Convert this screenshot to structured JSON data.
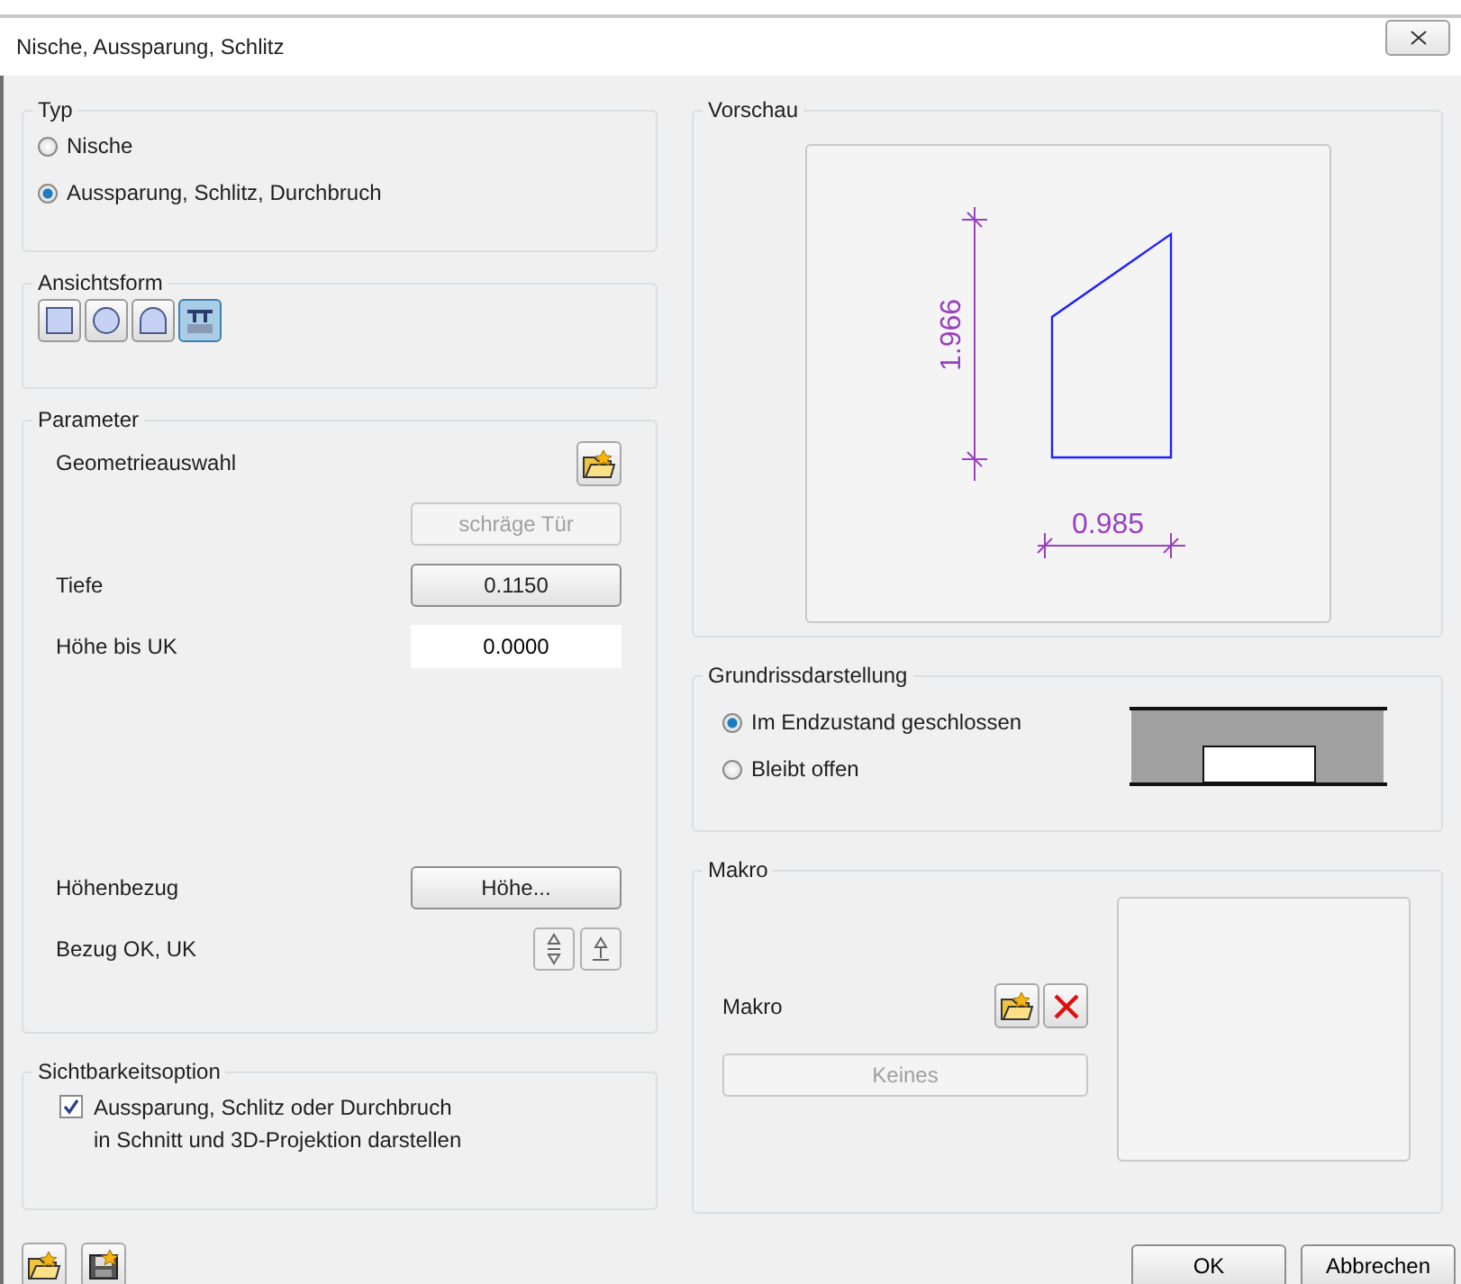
{
  "window": {
    "title": "Nische, Aussparung, Schlitz"
  },
  "typ": {
    "title": "Typ",
    "options": [
      {
        "label": "Nische",
        "selected": false
      },
      {
        "label": "Aussparung, Schlitz, Durchbruch",
        "selected": true
      }
    ]
  },
  "ansichtsform": {
    "title": "Ansichtsform",
    "shapes": [
      {
        "kind": "rectangle",
        "selected": false
      },
      {
        "kind": "circle",
        "selected": false
      },
      {
        "kind": "arch",
        "selected": false
      },
      {
        "kind": "custom",
        "selected": true
      }
    ]
  },
  "parameter": {
    "title": "Parameter",
    "rows": [
      {
        "kind": "icon",
        "label": "Geometrieauswahl"
      },
      {
        "kind": "button",
        "value": "schräge Tür",
        "disabled": true
      },
      {
        "kind": "button",
        "label": "Tiefe",
        "value": "0.1150",
        "disabled": false
      },
      {
        "kind": "input",
        "label": "Höhe bis UK",
        "value": "0.0000"
      }
    ],
    "reference_rows": [
      {
        "kind": "button",
        "label": "Höhenbezug",
        "value": "Höhe...",
        "disabled": false
      },
      {
        "kind": "toggles",
        "label": "Bezug OK, UK"
      }
    ]
  },
  "sichtbarkeit": {
    "title": "Sichtbarkeitsoption",
    "checked": true,
    "label": "Aussparung, Schlitz oder Durchbruch\nin Schnitt und 3D-Projektion darstellen"
  },
  "vorschau": {
    "title": "Vorschau",
    "height_dimension": "1.966",
    "width_dimension": "0.985"
  },
  "grundriss": {
    "title": "Grundrissdarstellung",
    "options": [
      {
        "label": "Im Endzustand geschlossen",
        "selected": true
      },
      {
        "label": "Bleibt offen",
        "selected": false
      }
    ]
  },
  "makro": {
    "title": "Makro",
    "label": "Makro",
    "button": {
      "label": "Keines",
      "disabled": true
    }
  },
  "buttons": [
    "OK",
    "Abbrechen"
  ]
}
